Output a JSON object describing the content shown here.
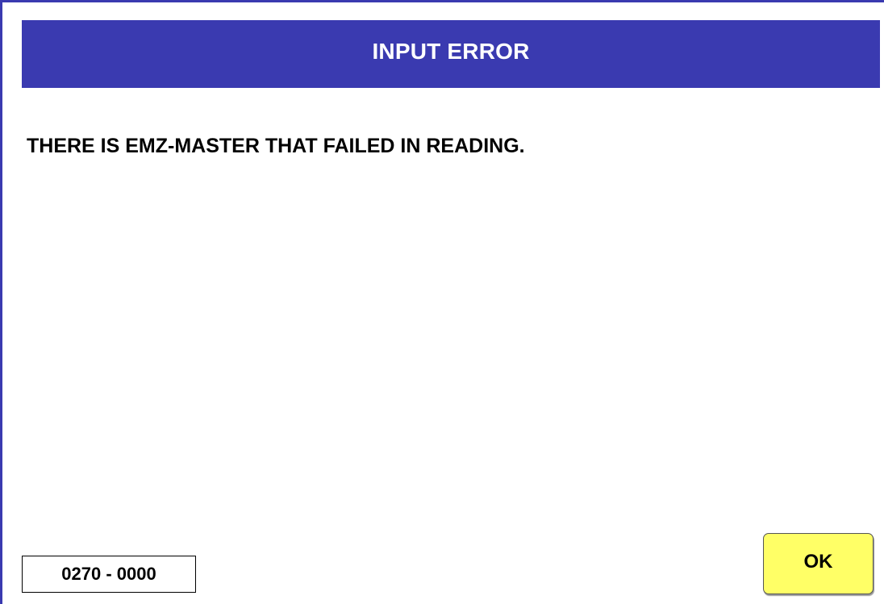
{
  "dialog": {
    "title": "INPUT ERROR",
    "message": "THERE IS EMZ-MASTER THAT FAILED IN READING.",
    "error_code": "0270 - 0000",
    "ok_label": "OK"
  },
  "colors": {
    "title_bar": "#3a3ab0",
    "title_text": "#ffffff",
    "ok_button": "#ffff66",
    "background": "#ffffff"
  }
}
